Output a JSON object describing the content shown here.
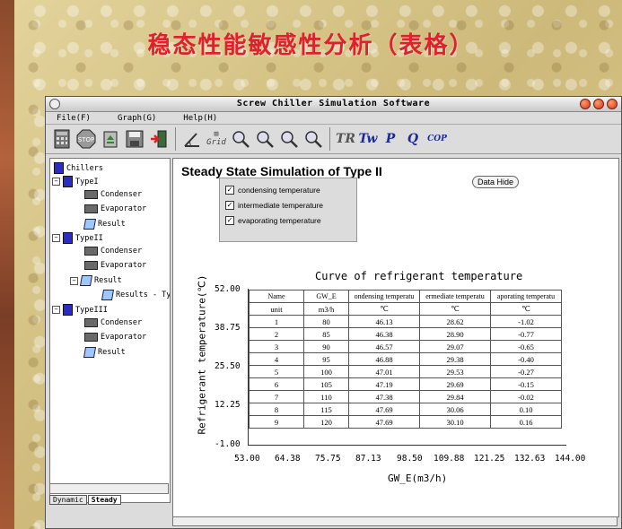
{
  "slide": {
    "title": "稳态性能敏感性分析（表格）"
  },
  "window": {
    "title": "Screw Chiller Simulation Software"
  },
  "menu": {
    "file": "File(F)",
    "graph": "Graph(G)",
    "help": "Help(H)"
  },
  "toolbar": {
    "grid_label": "Grid",
    "tr_label": "TR",
    "tw_label": "Tw",
    "p_label": "P",
    "q_label": "Q",
    "cop_label": "COP",
    "icons": [
      "calculator-icon",
      "stop-icon",
      "recycle-icon",
      "save-icon",
      "exit-icon",
      "angle-icon",
      "grid-icon",
      "zoom-in-icon",
      "zoom-out-icon",
      "zoom-fit-icon",
      "zoom-reset-icon"
    ]
  },
  "tree": {
    "root": "Chillers",
    "type1": "TypeI",
    "type2": "TypeII",
    "type3": "TypeIII",
    "condenser": "Condenser",
    "evaporator": "Evaporator",
    "result": "Result",
    "results_ty": "Results - Ty"
  },
  "tabs": {
    "dynamic": "Dynamic",
    "steady": "Steady"
  },
  "main": {
    "title": "Steady State Simulation of Type II",
    "data_hide": "Data Hide",
    "checks": [
      "condensing temperature",
      "intermediate temperature",
      "evaporating temperature"
    ]
  },
  "chart_data": {
    "type": "table",
    "title": "Curve of refrigerant temperature",
    "xlabel": "GW_E(m3/h)",
    "ylabel": "Refrigerant temperature(℃)",
    "y_ticks": [
      "52.00",
      "38.75",
      "25.50",
      "12.25",
      "-1.00"
    ],
    "x_ticks": [
      "53.00",
      "64.38",
      "75.75",
      "87.13",
      "98.50",
      "109.88",
      "121.25",
      "132.63",
      "144.00"
    ],
    "xlim": [
      53.0,
      144.0
    ],
    "ylim": [
      -1.0,
      52.0
    ],
    "table": {
      "headers": [
        "Name",
        "GW_E",
        "ondensing temperatu",
        "ermediate temperatu",
        "aporating temperatu"
      ],
      "units": [
        "unit",
        "m3/h",
        "℃",
        "℃",
        "℃"
      ],
      "rows": [
        [
          "1",
          "80",
          "46.13",
          "28.62",
          "-1.02"
        ],
        [
          "2",
          "85",
          "46.38",
          "28.90",
          "-0.77"
        ],
        [
          "3",
          "90",
          "46.57",
          "29.07",
          "-0.65"
        ],
        [
          "4",
          "95",
          "46.88",
          "29.38",
          "-0.40"
        ],
        [
          "5",
          "100",
          "47.01",
          "29.53",
          "-0.27"
        ],
        [
          "6",
          "105",
          "47.19",
          "29.69",
          "-0.15"
        ],
        [
          "7",
          "110",
          "47.38",
          "29.84",
          "-0.02"
        ],
        [
          "8",
          "115",
          "47.69",
          "30.06",
          "0.10"
        ],
        [
          "9",
          "120",
          "47.69",
          "30.10",
          "0.16"
        ]
      ]
    }
  }
}
